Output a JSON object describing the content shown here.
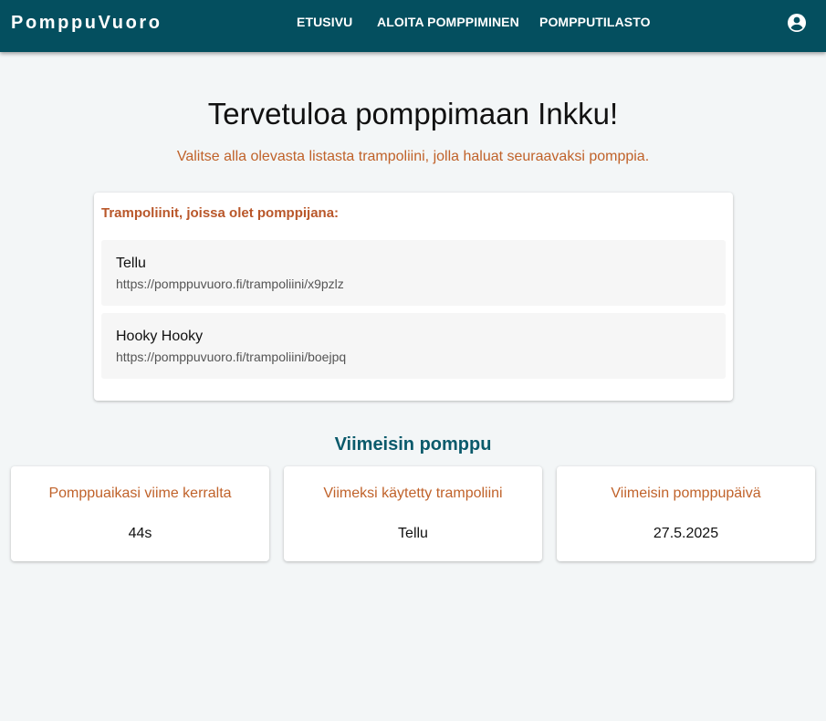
{
  "header": {
    "brand": "PomppuVuoro",
    "nav": [
      "ETUSIVU",
      "ALOITA POMPPIMINEN",
      "POMPPUTILASTO"
    ],
    "account_icon": "account-circle-icon"
  },
  "main": {
    "title": "Tervetuloa pomppimaan Inkku!",
    "subtitle": "Valitse alla olevasta listasta trampoliini, jolla haluat seuraavaksi pomppia."
  },
  "trampolines": {
    "heading": "Trampoliinit, joissa olet pomppijana:",
    "items": [
      {
        "name": "Tellu",
        "url": "https://pomppuvuoro.fi/trampoliini/x9pzlz"
      },
      {
        "name": "Hooky Hooky",
        "url": "https://pomppuvuoro.fi/trampoliini/boejpq"
      }
    ]
  },
  "last_bounce": {
    "heading": "Viimeisin pomppu",
    "stats": [
      {
        "label": "Pomppuaikasi viime kerralta",
        "value": "44s"
      },
      {
        "label": "Viimeksi käytetty trampoliini",
        "value": "Tellu"
      },
      {
        "label": "Viimeisin pomppupäivä",
        "value": "27.5.2025"
      }
    ]
  },
  "colors": {
    "appbar": "#044f5f",
    "accent_orange": "#c0622a",
    "section_teal": "#0a5a6b",
    "background": "#f3f6f7"
  }
}
